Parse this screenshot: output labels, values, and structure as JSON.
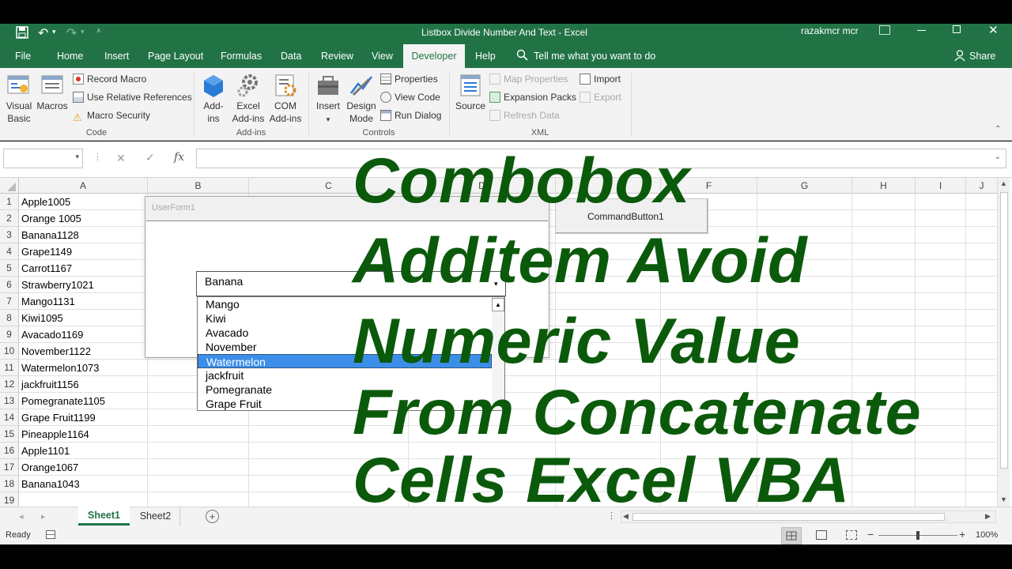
{
  "window": {
    "title": "Listbox Divide Number And Text  -  Excel",
    "user": "razakmcr mcr"
  },
  "tabs": [
    "File",
    "Home",
    "Insert",
    "Page Layout",
    "Formulas",
    "Data",
    "Review",
    "View",
    "Developer",
    "Help"
  ],
  "active_tab": "Developer",
  "tell_me": "Tell me what you want to do",
  "share": "Share",
  "ribbon": {
    "code": {
      "visual_basic_1": "Visual",
      "visual_basic_2": "Basic",
      "macros": "Macros",
      "record_macro": "Record Macro",
      "relative_refs": "Use Relative References",
      "macro_security": "Macro Security",
      "label": "Code"
    },
    "addins": {
      "addins_1": "Add-",
      "addins_2": "ins",
      "excel_addins_1": "Excel",
      "excel_addins_2": "Add-ins",
      "com_addins_1": "COM",
      "com_addins_2": "Add-ins",
      "label": "Add-ins"
    },
    "controls": {
      "insert": "Insert",
      "design_mode_1": "Design",
      "design_mode_2": "Mode",
      "properties": "Properties",
      "view_code": "View Code",
      "run_dialog": "Run Dialog",
      "label": "Controls"
    },
    "xml": {
      "source": "Source",
      "map_properties": "Map Properties",
      "expansion_packs": "Expansion Packs",
      "refresh_data": "Refresh Data",
      "import": "Import",
      "export": "Export",
      "label": "XML"
    }
  },
  "formula_bar": {
    "name_box": "",
    "fx": "fx",
    "content": ""
  },
  "columns": [
    "A",
    "B",
    "C",
    "D",
    "E",
    "F",
    "G",
    "H",
    "I",
    "J"
  ],
  "rows": [
    {
      "n": "1",
      "a": "Apple1005"
    },
    {
      "n": "2",
      "a": "Orange 1005"
    },
    {
      "n": "3",
      "a": "Banana1128"
    },
    {
      "n": "4",
      "a": "Grape1149"
    },
    {
      "n": "5",
      "a": "Carrot1167"
    },
    {
      "n": "6",
      "a": "Strawberry1021"
    },
    {
      "n": "7",
      "a": "Mango1131"
    },
    {
      "n": "8",
      "a": "Kiwi1095"
    },
    {
      "n": "9",
      "a": "Avacado1169"
    },
    {
      "n": "10",
      "a": "November1122"
    },
    {
      "n": "11",
      "a": "Watermelon1073"
    },
    {
      "n": "12",
      "a": "jackfruit1156"
    },
    {
      "n": "13",
      "a": "Pomegranate1105"
    },
    {
      "n": "14",
      "a": "Grape Fruit1199"
    },
    {
      "n": "15",
      "a": "Pineapple1164"
    },
    {
      "n": "16",
      "a": "Apple1101"
    },
    {
      "n": "17",
      "a": "Orange1067"
    },
    {
      "n": "18",
      "a": "Banana1043"
    },
    {
      "n": "19",
      "a": ""
    }
  ],
  "userform": {
    "title": "UserForm1",
    "combo_value": "Banana",
    "list_items": [
      "Mango",
      "Kiwi",
      "Avacado",
      "November",
      "Watermelon",
      "jackfruit",
      "Pomegranate",
      "Grape Fruit"
    ],
    "selected_item": "Watermelon"
  },
  "command_button": "CommandButton1",
  "sheets": [
    "Sheet1",
    "Sheet2"
  ],
  "active_sheet": "Sheet1",
  "status": {
    "ready": "Ready",
    "zoom": "100%"
  },
  "overlay": [
    "Combobox",
    "Additem Avoid",
    "Numeric Value",
    "From Concatenate",
    "Cells Excel VBA"
  ],
  "colors": {
    "excel_green": "#217346",
    "overlay_green": "#0b5a0b",
    "selection_blue": "#3c8ee8"
  }
}
